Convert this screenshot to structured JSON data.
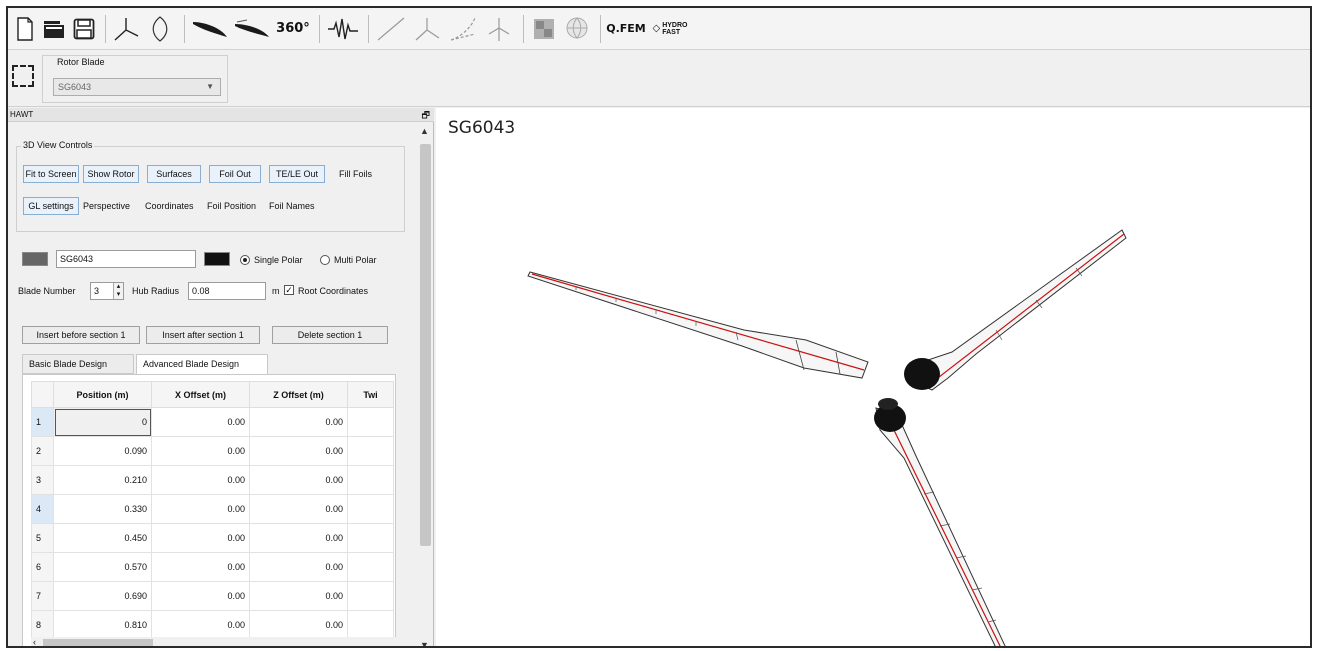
{
  "toolbar": {
    "icons": [
      "new-file-icon",
      "open-folder-icon",
      "save-icon",
      "blade-view-icon",
      "airfoil-icon",
      "foil-design-icon",
      "foil-tool-icon",
      "polar-360-icon",
      "signal-icon",
      "line-icon",
      "turbine-icon",
      "extrapolate-icon",
      "rotor-icon",
      "texture-icon",
      "globe-icon",
      "qfem-icon",
      "qblade-fast-icon"
    ],
    "label_360": "360°",
    "label_qfem": "Q.FEM",
    "label_fast_top": "HYDRO",
    "label_fast_bottom": "FAST"
  },
  "rotor_blade": {
    "label": "Rotor Blade",
    "selected": "SG6043"
  },
  "panel": {
    "title": "HAWT",
    "view_controls": {
      "title": "3D View Controls",
      "buttons": [
        "Fit to Screen",
        "Show Rotor",
        "Surfaces",
        "Foil Out",
        "TE/LE Out"
      ],
      "fill_foils": "Fill Foils",
      "buttons_row2": [
        "GL settings"
      ],
      "labels_row2": [
        "Perspective",
        "Coordinates",
        "Foil Position",
        "Foil Names"
      ]
    },
    "blade_name": "SG6043",
    "single_polar": "Single Polar",
    "multi_polar": "Multi Polar",
    "blade_number_label": "Blade Number",
    "blade_number": "3",
    "hub_radius_label": "Hub Radius",
    "hub_radius": "0.08",
    "hub_radius_unit": "m",
    "root_coordinates": "Root Coordinates",
    "insert_before": "Insert before section 1",
    "insert_after": "Insert after section 1",
    "delete_section": "Delete section 1",
    "tabs": [
      "Basic Blade Design",
      "Advanced Blade Design"
    ],
    "active_tab": 1,
    "table": {
      "columns": [
        "Position (m)",
        "X Offset (m)",
        "Z Offset (m)",
        "Twi"
      ],
      "rows": [
        {
          "n": "1",
          "pos": "0",
          "x": "0.00",
          "z": "0.00"
        },
        {
          "n": "2",
          "pos": "0.090",
          "x": "0.00",
          "z": "0.00"
        },
        {
          "n": "3",
          "pos": "0.210",
          "x": "0.00",
          "z": "0.00"
        },
        {
          "n": "4",
          "pos": "0.330",
          "x": "0.00",
          "z": "0.00"
        },
        {
          "n": "5",
          "pos": "0.450",
          "x": "0.00",
          "z": "0.00"
        },
        {
          "n": "6",
          "pos": "0.570",
          "x": "0.00",
          "z": "0.00"
        },
        {
          "n": "7",
          "pos": "0.690",
          "x": "0.00",
          "z": "0.00"
        },
        {
          "n": "8",
          "pos": "0.810",
          "x": "0.00",
          "z": "0.00"
        }
      ]
    }
  },
  "view": {
    "title": "SG6043",
    "blade_color": "#333333",
    "axis_color": "#cc1111"
  }
}
